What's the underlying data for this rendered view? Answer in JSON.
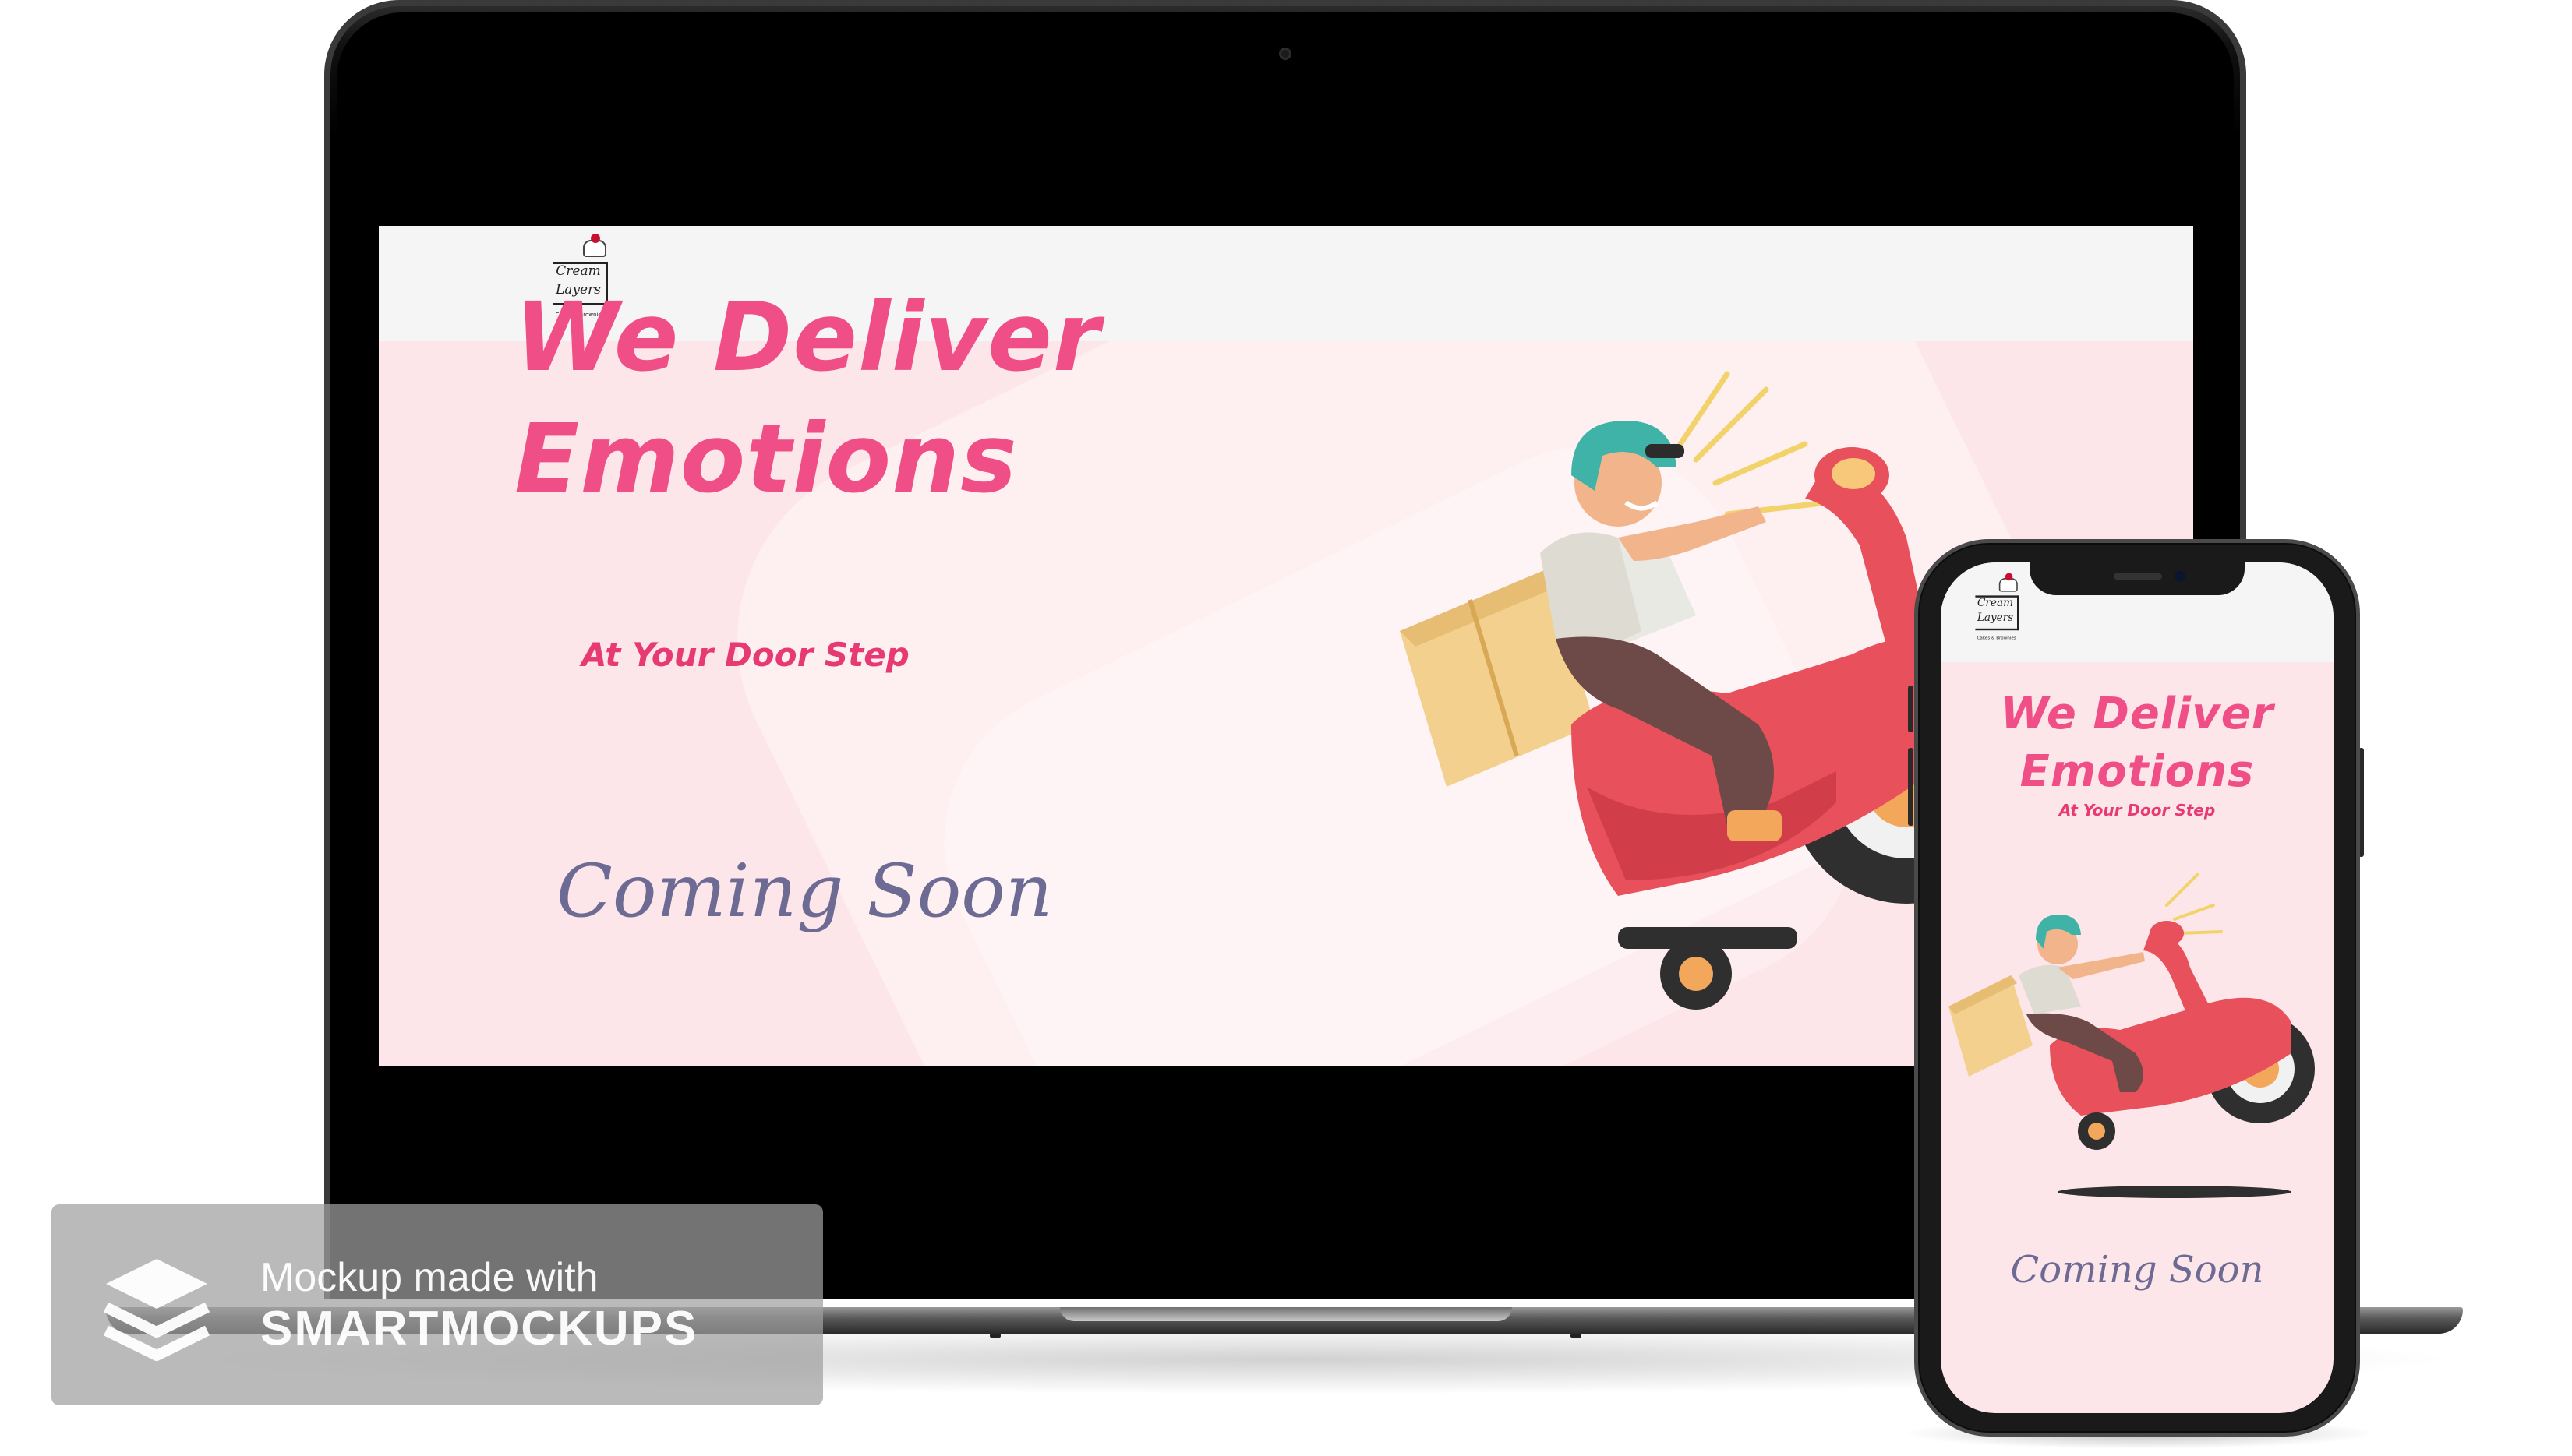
{
  "brand": {
    "logo_line1": "Cream",
    "logo_line2": "Layers",
    "logo_tagline": "Cakes & Brownies"
  },
  "hero": {
    "headline_line1": "We Deliver",
    "headline_line2": "Emotions",
    "subheadline": "At Your Door Step",
    "status": "Coming Soon"
  },
  "watermark": {
    "line1": "Mockup made with",
    "line2": "SMARTMOCKUPS"
  },
  "colors": {
    "page_background": "#fde6ea",
    "nav_background": "#f5f5f5",
    "headline": "#ef4f86",
    "subheadline": "#e73a74",
    "coming_soon": "#6d6a94",
    "scooter": "#e8505b",
    "helmet": "#3fb3a8",
    "parcel": "#f3d08e"
  },
  "illustration": {
    "name": "delivery-rider-on-scooter",
    "icon": "scooter-icon"
  }
}
